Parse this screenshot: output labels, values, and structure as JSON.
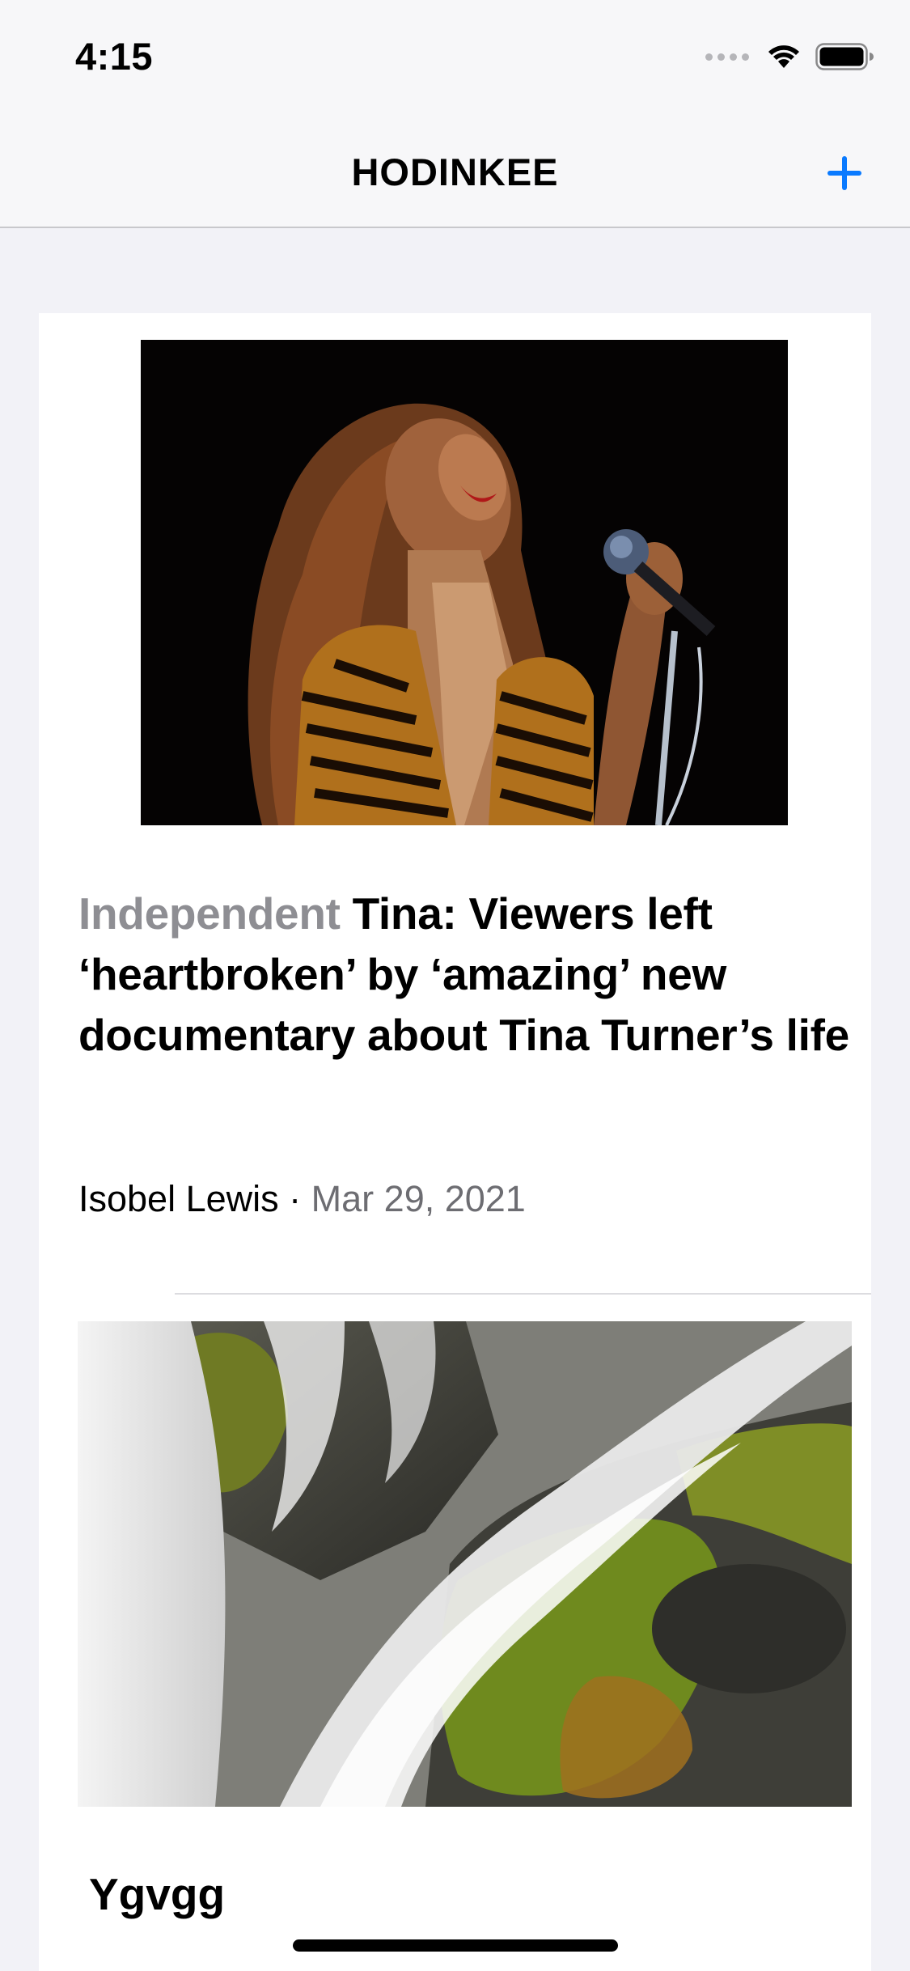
{
  "status_bar": {
    "time": "4:15"
  },
  "nav": {
    "title": "HODINKEE",
    "add_icon": "plus-icon",
    "accent_color": "#0a7aff"
  },
  "feed": {
    "items": [
      {
        "source": "Independent",
        "title": "Tina: Viewers left ‘heartbroken’ by ‘amazing’ new documentary about Tina Turner’s life",
        "author": "Isobel Lewis",
        "separator": "·",
        "date": "Mar 29, 2021",
        "image": "singer-photo"
      },
      {
        "title": "Ygvgg",
        "image": "waterfall-photo"
      }
    ]
  }
}
